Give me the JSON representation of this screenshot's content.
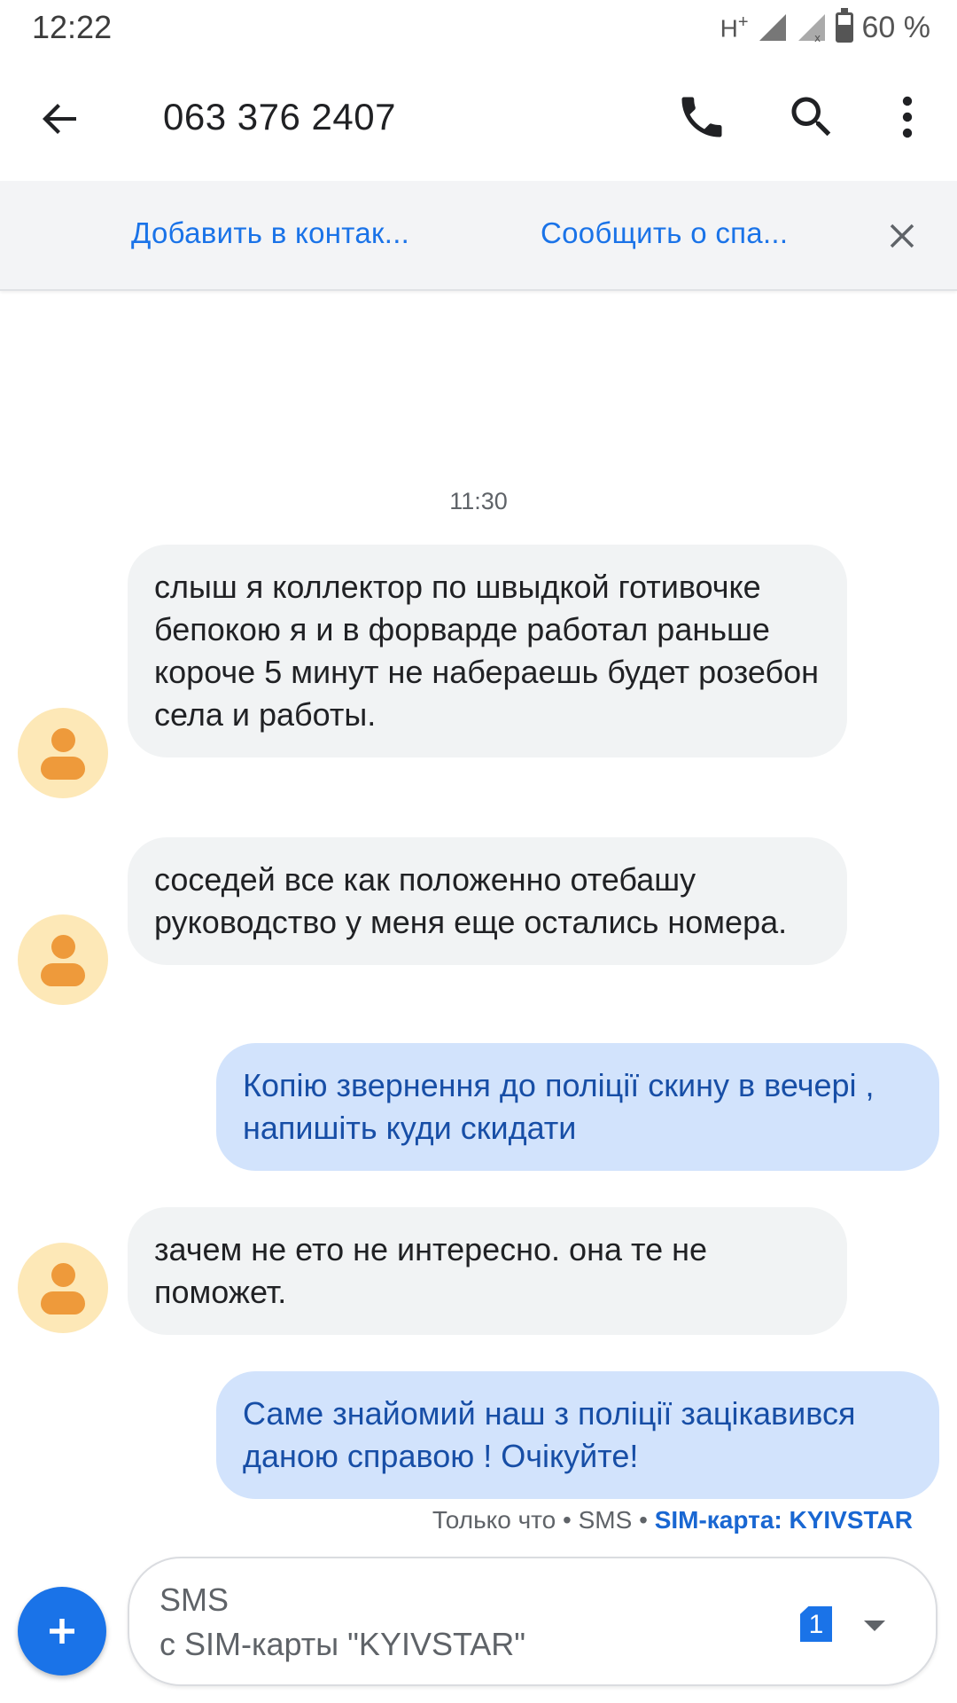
{
  "status_bar": {
    "time": "12:22",
    "network": "H",
    "network_sup": "+",
    "battery": "60 %"
  },
  "app_bar": {
    "title": "063 376 2407",
    "icons": [
      "back-arrow-icon",
      "phone-icon",
      "search-icon",
      "more-vert-icon"
    ]
  },
  "spam_banner": {
    "add_contact": "Добавить в контак...",
    "report_spam": "Сообщить о спа..."
  },
  "conversation": {
    "timestamp": "11:30",
    "messages": [
      {
        "direction": "incoming",
        "text": "слыш я коллектор по швыдкой готивочке бепокою я и в форварде работал раньше короче 5 минут не набераешь будет розебон села и работы."
      },
      {
        "direction": "incoming",
        "text": "соседей все как положенно отебашу руководство у меня еще остались номера."
      },
      {
        "direction": "outgoing",
        "text": "Копію звернення до поліції скину в вечері , напишіть куди скидати"
      },
      {
        "direction": "incoming",
        "text": "зачем не ето не интересно. она те не поможет."
      },
      {
        "direction": "outgoing",
        "text": "Саме знайомий наш з поліції зацікавився даною справою ! Очікуйте!"
      }
    ],
    "last_meta": {
      "time": "Только что",
      "separator": "•",
      "type": "SMS",
      "sim": "SIM-карта: KYIVSTAR"
    }
  },
  "compose": {
    "placeholder_line1": "SMS",
    "placeholder_line2": "с SIM-карты \"KYIVSTAR\"",
    "sim_number": "1"
  },
  "colors": {
    "accent": "#1a73e8",
    "incoming_bubble": "#f1f3f4",
    "outgoing_bubble": "#d2e3fc",
    "outgoing_text": "#174ea6",
    "avatar_bg": "#fde8b7",
    "avatar_fg": "#ee9a3b"
  }
}
